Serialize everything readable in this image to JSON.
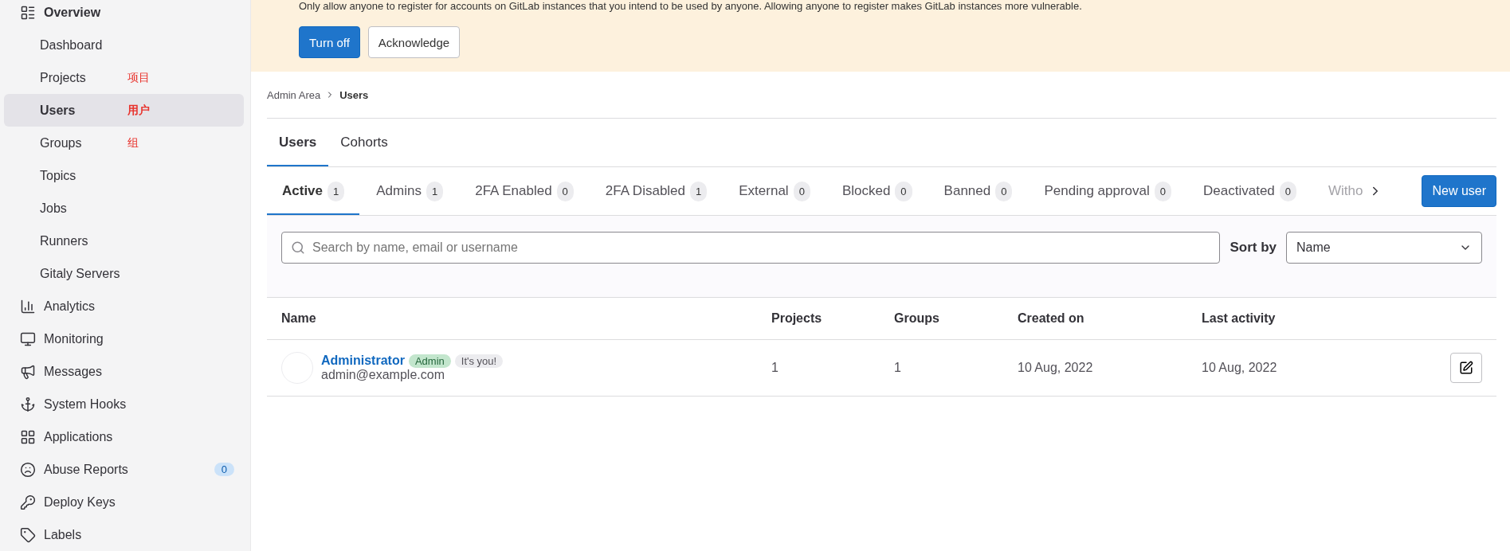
{
  "sidebar": {
    "items": [
      {
        "kind": "section",
        "label": "Overview",
        "selected": false
      },
      {
        "kind": "sub",
        "label": "Dashboard",
        "selected": false
      },
      {
        "kind": "sub",
        "label": "Projects",
        "selected": false,
        "annotation": "项目"
      },
      {
        "kind": "sub",
        "label": "Users",
        "selected": true,
        "annotation": "用户"
      },
      {
        "kind": "sub",
        "label": "Groups",
        "selected": false,
        "annotation": "组"
      },
      {
        "kind": "sub",
        "label": "Topics",
        "selected": false
      },
      {
        "kind": "sub",
        "label": "Jobs",
        "selected": false
      },
      {
        "kind": "sub",
        "label": "Runners",
        "selected": false
      },
      {
        "kind": "sub",
        "label": "Gitaly Servers",
        "selected": false
      },
      {
        "kind": "section",
        "label": "Analytics",
        "selected": false
      },
      {
        "kind": "section",
        "label": "Monitoring",
        "selected": false
      },
      {
        "kind": "section",
        "label": "Messages",
        "selected": false
      },
      {
        "kind": "section",
        "label": "System Hooks",
        "selected": false
      },
      {
        "kind": "section",
        "label": "Applications",
        "selected": false
      },
      {
        "kind": "section",
        "label": "Abuse Reports",
        "selected": false,
        "badge": "0"
      },
      {
        "kind": "section",
        "label": "Deploy Keys",
        "selected": false
      },
      {
        "kind": "section",
        "label": "Labels",
        "selected": false
      }
    ]
  },
  "banner": {
    "text": "Only allow anyone to register for accounts on GitLab instances that you intend to be used by anyone. Allowing anyone to register makes GitLab instances more vulnerable.",
    "buttons": [
      {
        "label": "Turn off",
        "kind": "primary"
      },
      {
        "label": "Acknowledge",
        "kind": "default"
      }
    ]
  },
  "breadcrumb": [
    "Admin Area",
    "Users"
  ],
  "tabs": [
    {
      "label": "Users",
      "selected": true
    },
    {
      "label": "Cohorts",
      "selected": false
    }
  ],
  "filter_tabs": [
    {
      "label": "Active",
      "count": "1",
      "selected": true
    },
    {
      "label": "Admins",
      "count": "1",
      "selected": false
    },
    {
      "label": "2FA Enabled",
      "count": "0",
      "selected": false
    },
    {
      "label": "2FA Disabled",
      "count": "1",
      "selected": false
    },
    {
      "label": "External",
      "count": "0",
      "selected": false
    },
    {
      "label": "Blocked",
      "count": "0",
      "selected": false
    },
    {
      "label": "Banned",
      "count": "0",
      "selected": false
    },
    {
      "label": "Pending approval",
      "count": "0",
      "selected": false
    },
    {
      "label": "Deactivated",
      "count": "0",
      "selected": false
    },
    {
      "label": "Witho",
      "selected": false
    }
  ],
  "new_user_button": "New user",
  "search": {
    "placeholder": "Search by name, email or username"
  },
  "sort": {
    "label": "Sort by",
    "value": "Name"
  },
  "table": {
    "columns": [
      "Name",
      "Projects",
      "Groups",
      "Created on",
      "Last activity"
    ],
    "rows": [
      {
        "name": "Administrator",
        "email": "admin@example.com",
        "badges": [
          {
            "label": "Admin",
            "kind": "admin"
          },
          {
            "label": "It's you!",
            "kind": "self"
          }
        ],
        "projects": "1",
        "groups": "1",
        "created_on": "10 Aug, 2022",
        "last_activity": "10 Aug, 2022"
      }
    ]
  }
}
